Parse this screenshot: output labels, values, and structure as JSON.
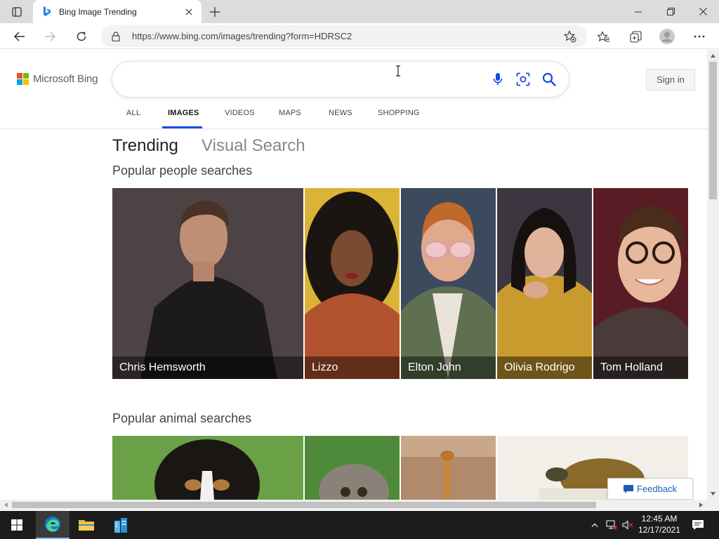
{
  "browser": {
    "tab_title": "Bing Image Trending",
    "url": "https://www.bing.com/images/trending?form=HDRSC2"
  },
  "bing": {
    "logo_text": "Microsoft Bing",
    "search_value": "",
    "sign_in_label": "Sign in",
    "scopes": [
      "ALL",
      "IMAGES",
      "VIDEOS",
      "MAPS",
      "NEWS",
      "SHOPPING"
    ],
    "active_scope": "IMAGES",
    "pivots": [
      "Trending",
      "Visual Search"
    ],
    "active_pivot": "Trending"
  },
  "sections": {
    "people_title": "Popular people searches",
    "people": [
      "Chris Hemsworth",
      "Lizzo",
      "Elton John",
      "Olivia Rodrigo",
      "Tom Holland"
    ],
    "animals_title": "Popular animal searches"
  },
  "feedback_label": "Feedback",
  "taskbar": {
    "time": "12:45 AM",
    "date": "12/17/2021"
  },
  "colors": {
    "accent": "#174ae4",
    "ms_red": "#f25022",
    "ms_green": "#7fba00",
    "ms_blue": "#00a4ef",
    "ms_yellow": "#ffb900"
  }
}
